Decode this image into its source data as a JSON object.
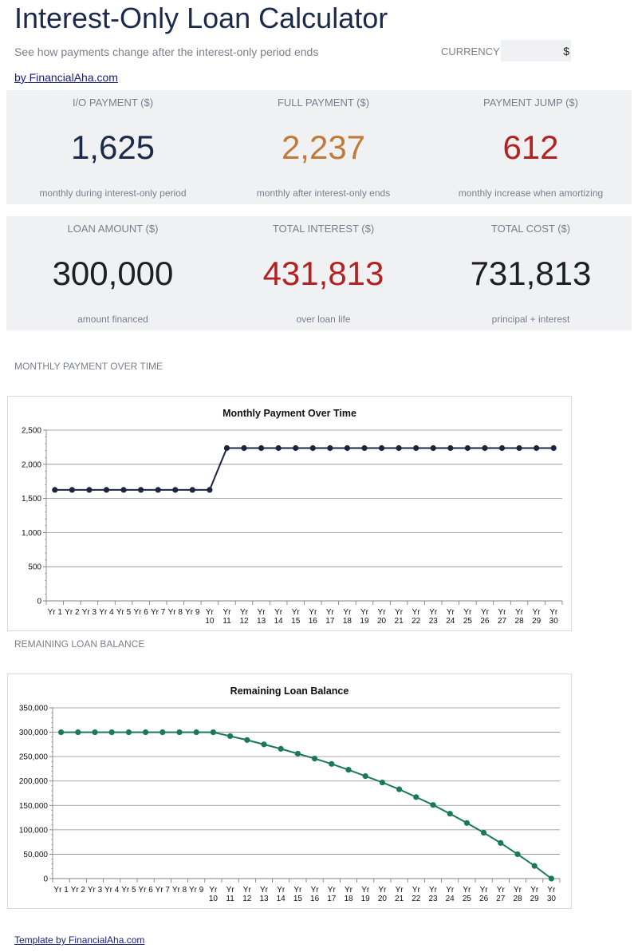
{
  "header": {
    "title": "Interest-Only Loan Calculator",
    "subtitle": "See how payments change after the interest-only period ends",
    "currency_label": "CURRENCY",
    "currency_value": "$",
    "byline": "by FinancialAha.com"
  },
  "kpis_row1": [
    {
      "label": "I/O PAYMENT ($)",
      "value": "1,625",
      "sub": "monthly during interest-only period",
      "color": "#1c2a4a"
    },
    {
      "label": "FULL PAYMENT ($)",
      "value": "2,237",
      "sub": "monthly after interest-only ends",
      "color": "#c07a3a"
    },
    {
      "label": "PAYMENT JUMP ($)",
      "value": "612",
      "sub": "monthly increase when amortizing",
      "color": "#b22222"
    }
  ],
  "kpis_row2": [
    {
      "label": "LOAN AMOUNT ($)",
      "value": "300,000",
      "sub": "amount financed",
      "color": "#1e1e24"
    },
    {
      "label": "TOTAL INTEREST ($)",
      "value": "431,813",
      "sub": "over loan life",
      "color": "#b22222"
    },
    {
      "label": "TOTAL COST ($)",
      "value": "731,813",
      "sub": "principal + interest",
      "color": "#1e1e24"
    }
  ],
  "sections": {
    "payment_label": "MONTHLY PAYMENT OVER TIME",
    "balance_label": "REMAINING LOAN BALANCE"
  },
  "footer": {
    "text": "Template by FinancialAha.com"
  },
  "chart_data": [
    {
      "type": "line",
      "title": "Monthly Payment Over Time",
      "categories": [
        "Yr 1",
        "Yr 2",
        "Yr 3",
        "Yr 4",
        "Yr 5",
        "Yr 6",
        "Yr 7",
        "Yr 8",
        "Yr 9",
        "Yr 10",
        "Yr 11",
        "Yr 12",
        "Yr 13",
        "Yr 14",
        "Yr 15",
        "Yr 16",
        "Yr 17",
        "Yr 18",
        "Yr 19",
        "Yr 20",
        "Yr 21",
        "Yr 22",
        "Yr 23",
        "Yr 24",
        "Yr 25",
        "Yr 26",
        "Yr 27",
        "Yr 28",
        "Yr 29",
        "Yr 30"
      ],
      "values": [
        1625,
        1625,
        1625,
        1625,
        1625,
        1625,
        1625,
        1625,
        1625,
        1625,
        2237,
        2237,
        2237,
        2237,
        2237,
        2237,
        2237,
        2237,
        2237,
        2237,
        2237,
        2237,
        2237,
        2237,
        2237,
        2237,
        2237,
        2237,
        2237,
        2237
      ],
      "yticks": [
        0,
        500,
        1000,
        1500,
        2000,
        2500
      ],
      "ylim": [
        0,
        2500
      ],
      "color": "#1c2540",
      "grid": true
    },
    {
      "type": "line",
      "title": "Remaining Loan Balance",
      "categories": [
        "Yr 1",
        "Yr 2",
        "Yr 3",
        "Yr 4",
        "Yr 5",
        "Yr 6",
        "Yr 7",
        "Yr 8",
        "Yr 9",
        "Yr 10",
        "Yr 11",
        "Yr 12",
        "Yr 13",
        "Yr 14",
        "Yr 15",
        "Yr 16",
        "Yr 17",
        "Yr 18",
        "Yr 19",
        "Yr 20",
        "Yr 21",
        "Yr 22",
        "Yr 23",
        "Yr 24",
        "Yr 25",
        "Yr 26",
        "Yr 27",
        "Yr 28",
        "Yr 29",
        "Yr 30"
      ],
      "values": [
        300000,
        300000,
        300000,
        300000,
        300000,
        300000,
        300000,
        300000,
        300000,
        300000,
        292000,
        284000,
        275000,
        266000,
        256000,
        246000,
        235000,
        223000,
        210000,
        197000,
        183000,
        167000,
        151000,
        133000,
        114000,
        94000,
        73000,
        50000,
        26000,
        0
      ],
      "yticks": [
        0,
        50000,
        100000,
        150000,
        200000,
        250000,
        300000,
        350000
      ],
      "ylim": [
        0,
        350000
      ],
      "color": "#1a7a55",
      "grid": true
    }
  ]
}
